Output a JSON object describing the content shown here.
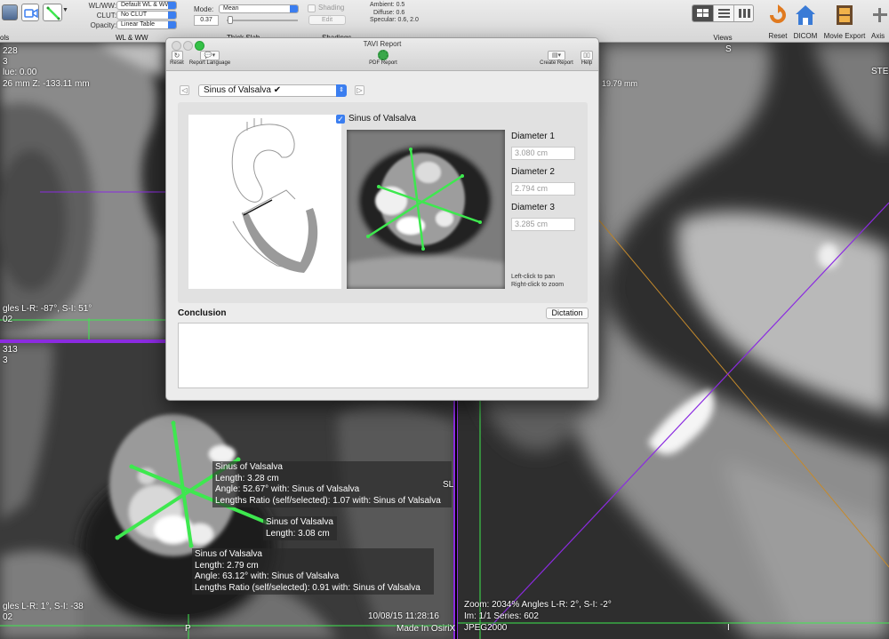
{
  "toolbar": {
    "tools_caption": "ols",
    "wlww": {
      "wl_label": "WL/WW:",
      "wl_value": "Default WL & WW",
      "clut_label": "CLUT:",
      "clut_value": "No CLUT",
      "opacity_label": "Opacity:",
      "opacity_value": "Linear Table",
      "group_caption": "WL & WW"
    },
    "thickslab": {
      "mode_label": "Mode:",
      "mode_value": "Mean",
      "thickness": "0.37",
      "group_caption": "Thick Slab"
    },
    "shadings": {
      "checkbox_label": "Shading",
      "edit_label": "Edit",
      "ambient": "Ambient: 0.5",
      "diffuse": "Diffuse: 0.6",
      "specular": "Specular: 0.6, 2.0",
      "group_caption": "Shadings"
    },
    "views_caption": "Views",
    "right_buttons": [
      "Reset",
      "DICOM",
      "Movie Export",
      "Axis"
    ]
  },
  "viewer_top_left": {
    "lines": [
      "228",
      "3",
      "lue: 0.00",
      "26 mm Z: -133.11 mm"
    ],
    "angles": "gles L-R: -87°, S-I: 51°",
    "series": "02"
  },
  "viewer_bottom_left": {
    "lines": [
      "313",
      "3"
    ],
    "angles": "gles L-R: 1°, S-I: -38",
    "series": "02",
    "date": "10/08/15 11:28:16",
    "made_in": "Made In OsiriX",
    "p_marker": "P",
    "sl_marker": "SL",
    "measurements": [
      {
        "name": "Sinus of Valsalva",
        "length": "Length: 3.28 cm",
        "angle": "Angle: 52.67° with: Sinus of Valsalva",
        "ratio": "Lengths Ratio (self/selected): 1.07 with: Sinus of Valsalva"
      },
      {
        "name": "Sinus of Valsalva",
        "length": "Length: 3.08 cm"
      },
      {
        "name": "Sinus of Valsalva",
        "length": "Length: 2.79 cm",
        "angle": "Angle: 63.12° with: Sinus of Valsalva",
        "ratio": "Lengths Ratio (self/selected): 0.91 with: Sinus of Valsalva"
      }
    ]
  },
  "viewer_right": {
    "top_label": "S",
    "partial_text": "19.79 mm",
    "ste": "STE",
    "zoom": "Zoom: 2034% Angles L-R: 2°, S-I: -2°",
    "image": "Im: 1/1  Series:  602",
    "codec": "JPEG2000",
    "bottom_marker": "I"
  },
  "dialog": {
    "title": "TAVI Report",
    "reset_label": "Reset",
    "language_label": "Report Language",
    "pdf_label": "PDF Report",
    "create_report_label": "Create Report",
    "help_label": "Help",
    "step_value": "Sinus of Valsalva ✔",
    "checkbox_label": "Sinus of Valsalva",
    "diameters": [
      {
        "label": "Diameter 1",
        "value": "3.080 cm"
      },
      {
        "label": "Diameter 2",
        "value": "2.794 cm"
      },
      {
        "label": "Diameter 3",
        "value": "3.285 cm"
      }
    ],
    "hint1": "Left-click to pan",
    "hint2": "Right-click to zoom",
    "conclusion_label": "Conclusion",
    "dictation_label": "Dictation",
    "conclusion_text": ""
  },
  "colors": {
    "measure_green": "#3ee84f",
    "crosshair_purple": "#8b2be0",
    "crosshair_orange": "#c58a2c",
    "dialog_bg": "#ececec",
    "accent_blue": "#3b7ef0"
  }
}
